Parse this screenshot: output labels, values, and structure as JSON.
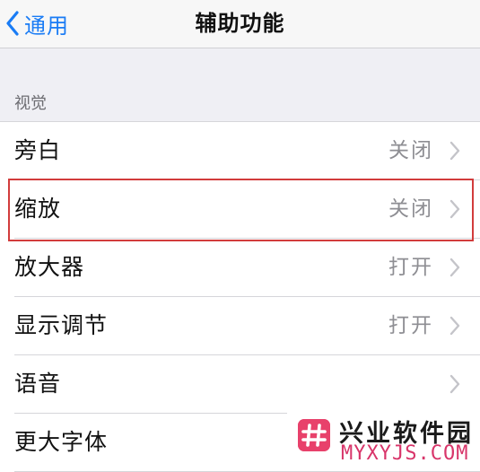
{
  "navbar": {
    "back_label": "通用",
    "title": "辅助功能"
  },
  "section": {
    "header": "视觉"
  },
  "rows": [
    {
      "label": "旁白",
      "value": "关闭"
    },
    {
      "label": "缩放",
      "value": "关闭"
    },
    {
      "label": "放大器",
      "value": "打开"
    },
    {
      "label": "显示调节",
      "value": "打开"
    },
    {
      "label": "语音",
      "value": ""
    },
    {
      "label": "更大字体",
      "value": ""
    }
  ],
  "watermark": {
    "title": "兴业软件园",
    "url": "MYXYJS.COM"
  },
  "colors": {
    "accent": "#1a7cf5",
    "highlight": "#d23c3c",
    "background": "#efeff4",
    "secondary_text": "#8e8e93",
    "watermark_pink": "#e8416b"
  },
  "icons": {
    "back": "chevron-left-icon",
    "disclosure": "chevron-right-icon",
    "watermark": "hash-logo-icon"
  }
}
